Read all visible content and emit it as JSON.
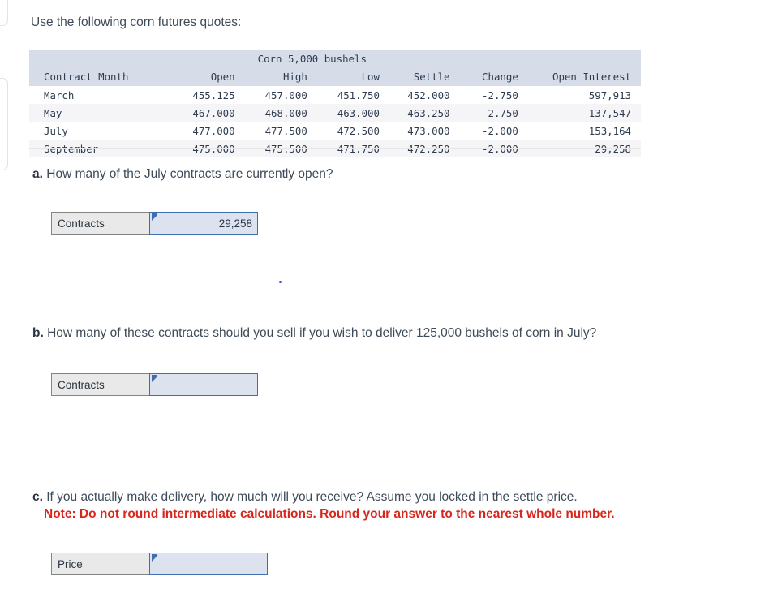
{
  "intro": "Use the following corn futures quotes:",
  "quotes_table": {
    "title": "Corn 5,000 bushels",
    "columns": [
      "Contract Month",
      "Open",
      "High",
      "Low",
      "Settle",
      "Change",
      "Open Interest"
    ],
    "rows": [
      {
        "month": "March",
        "open": "455.125",
        "high": "457.000",
        "low": "451.750",
        "settle": "452.000",
        "change": "-2.750",
        "open_interest": "597,913"
      },
      {
        "month": "May",
        "open": "467.000",
        "high": "468.000",
        "low": "463.000",
        "settle": "463.250",
        "change": "-2.750",
        "open_interest": "137,547"
      },
      {
        "month": "July",
        "open": "477.000",
        "high": "477.500",
        "low": "472.500",
        "settle": "473.000",
        "change": "-2.000",
        "open_interest": "153,164"
      },
      {
        "month": "September",
        "open": "475.000",
        "high": "475.500",
        "low": "471.750",
        "settle": "472.250",
        "change": "-2.000",
        "open_interest": "29,258"
      }
    ]
  },
  "questions": {
    "a": {
      "marker": "a.",
      "text": "How many of the July contracts are currently open?",
      "answer_label": "Contracts",
      "answer_value": "29,258",
      "answer_placeholder": ""
    },
    "b": {
      "marker": "b.",
      "text": "How many of these contracts should you sell if you wish to deliver 125,000 bushels of corn in July?",
      "answer_label": "Contracts",
      "answer_value": "",
      "answer_placeholder": ""
    },
    "c": {
      "marker": "c.",
      "text": "If you actually make delivery, how much will you receive? Assume you locked in the settle price.",
      "note": "Note: Do not round intermediate calculations. Round your answer to the nearest whole number.",
      "answer_label": "Price",
      "answer_value": "",
      "answer_placeholder": ""
    }
  },
  "colors": {
    "table_header_bg": "#d6dce8",
    "row_stripe_bg": "#f5f5f7",
    "input_border": "#3f6fb0",
    "input_bg": "#dde3ee",
    "label_bg": "#e9e9e9",
    "note_red": "#d9261c",
    "body_text": "#3d4a58"
  }
}
